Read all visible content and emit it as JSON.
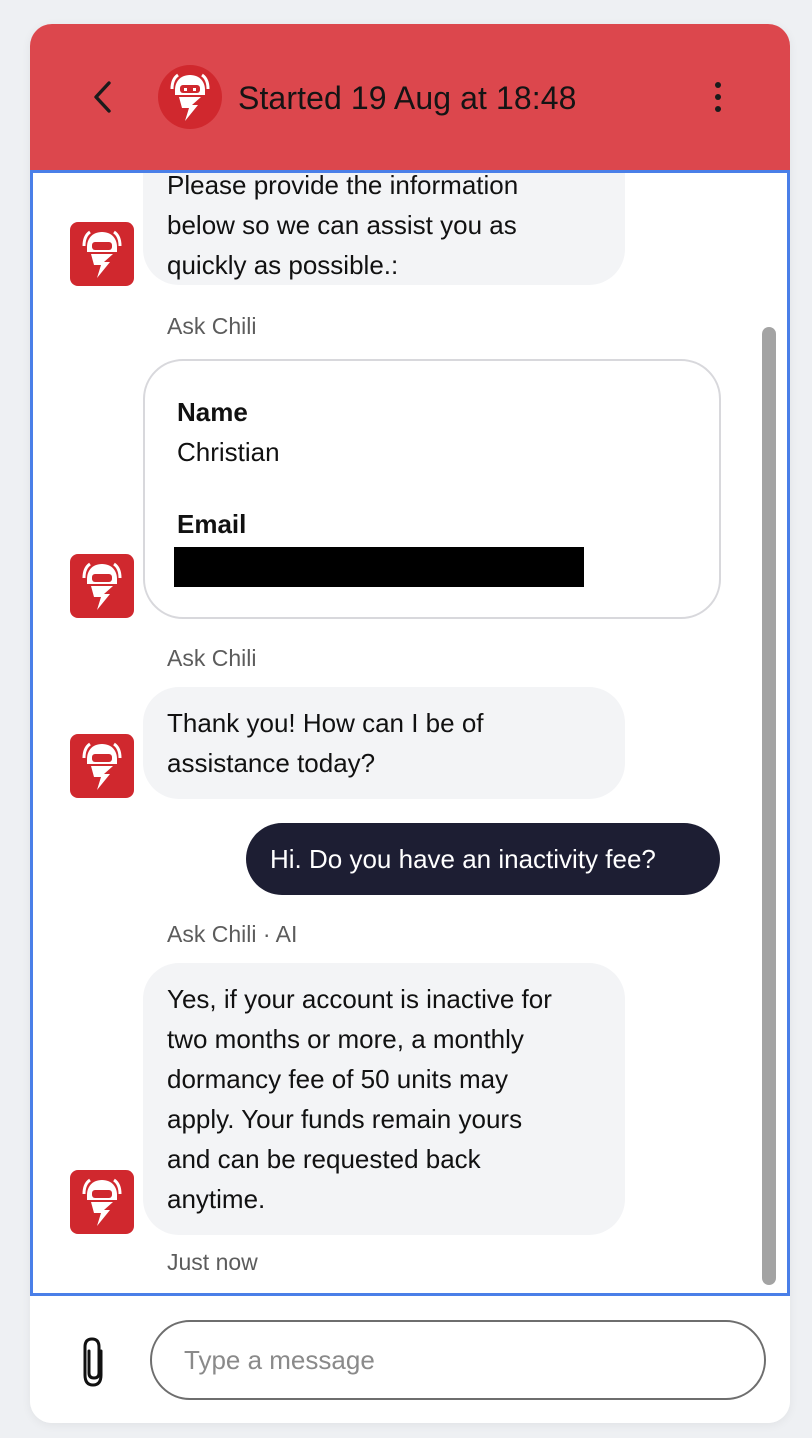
{
  "colors": {
    "header_bg": "#dc474d",
    "avatar_bg": "#d0282e",
    "bot_bubble_bg": "#f3f4f6",
    "user_bubble_bg": "#1d1e33",
    "focus_border": "#4a7fe8"
  },
  "header": {
    "title": "Started 19 Aug at 18:48",
    "back_icon": "chevron-left-icon",
    "avatar_icon": "chili-bot-icon",
    "menu_icon": "more-vertical-icon"
  },
  "messages": [
    {
      "sender": "bot",
      "lines": [
        "Please provide the information",
        "below so we can assist you as",
        "quickly as possible.:"
      ]
    },
    {
      "sender": "bot",
      "meta": "Ask Chili",
      "form": {
        "name_label": "Name",
        "name_value": "Christian",
        "email_label": "Email"
      }
    },
    {
      "sender": "bot",
      "meta": "Ask Chili",
      "lines": [
        "Thank you! How can I be of",
        "assistance today?"
      ]
    },
    {
      "sender": "user",
      "text": "Hi. Do you have an inactivity fee?"
    },
    {
      "sender": "bot",
      "meta": "Ask Chili · AI",
      "lines": [
        "Yes, if your account is inactive for",
        "two months or more, a monthly",
        "dormancy fee of 50 units may",
        "apply. Your funds remain yours",
        "and can be requested back",
        "anytime."
      ],
      "timestamp": "Just now"
    }
  ],
  "composer": {
    "placeholder": "Type a message",
    "attach_icon": "paperclip-icon"
  }
}
